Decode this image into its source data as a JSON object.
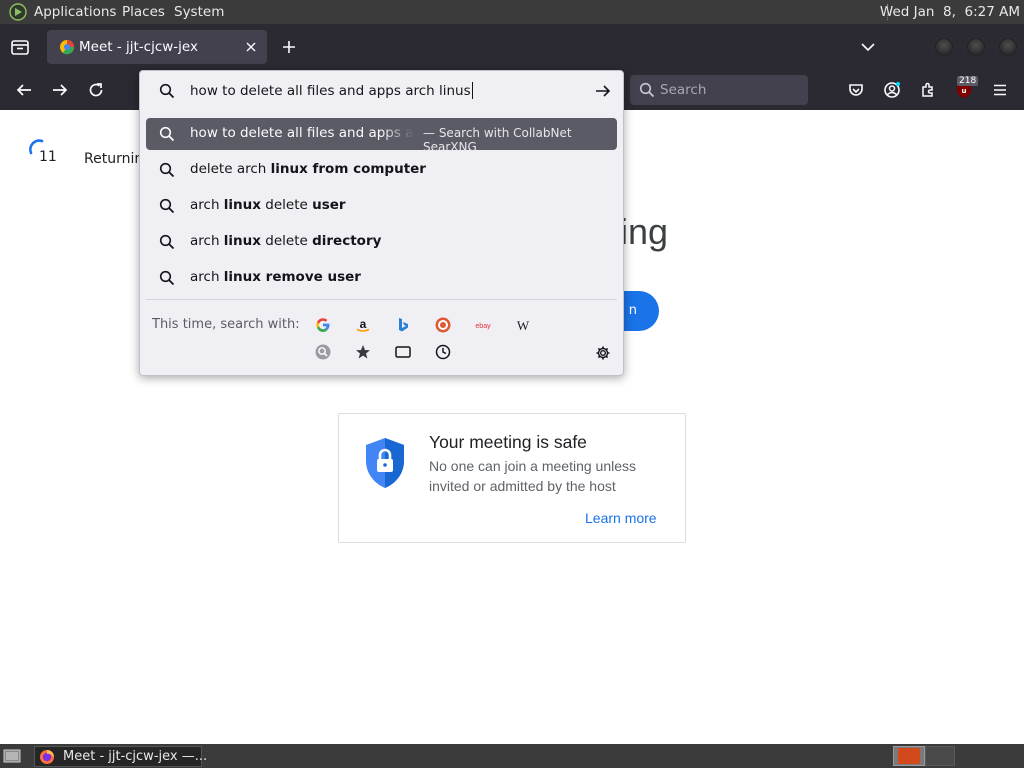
{
  "top_panel": {
    "menus": [
      "Applications",
      "Places",
      "System"
    ],
    "clock": "Wed Jan  8,  6:27 AM"
  },
  "tab": {
    "title": "Meet - jjt-cjcw-jex"
  },
  "nav": {
    "search_placeholder": "Search",
    "addon_badge": "218"
  },
  "urlbar": {
    "value": "how to delete all files and apps arch linus",
    "selected_suggestion": {
      "text": "how to delete all files and apps arch linus",
      "action": "— Search with CollabNet SearXNG"
    },
    "suggestions": [
      {
        "plain": "delete arch ",
        "bold": "linux from computer"
      },
      {
        "plain": "arch ",
        "bold": "linux",
        "plain2": " delete ",
        "bold2": "user"
      },
      {
        "plain": "arch ",
        "bold": "linux",
        "plain2": " delete ",
        "bold2": "directory"
      },
      {
        "plain": "arch ",
        "bold": "linux remove user"
      }
    ],
    "oneoff_label": "This time, search with:",
    "engines": [
      "google-icon",
      "amazon-icon",
      "bing-icon",
      "duckduckgo-icon",
      "ebay-icon",
      "wikipedia-icon"
    ],
    "ebay_text": "ebay",
    "wiki_text": "W"
  },
  "page": {
    "countdown": "11",
    "returning_text": "Returnin",
    "heading_fragment": "ing",
    "join_button_fragment": "n",
    "safe_card": {
      "title": "Your meeting is safe",
      "description": "No one can join a meeting unless invited or admitted by the host",
      "link": "Learn more"
    }
  },
  "taskbar": {
    "task_label": "Meet - jjt-cjcw-jex —..."
  },
  "colors": {
    "accent_blue": "#1a73e8",
    "toolbar_bg": "#2b2a33",
    "popup_selected": "#5b5b66"
  }
}
